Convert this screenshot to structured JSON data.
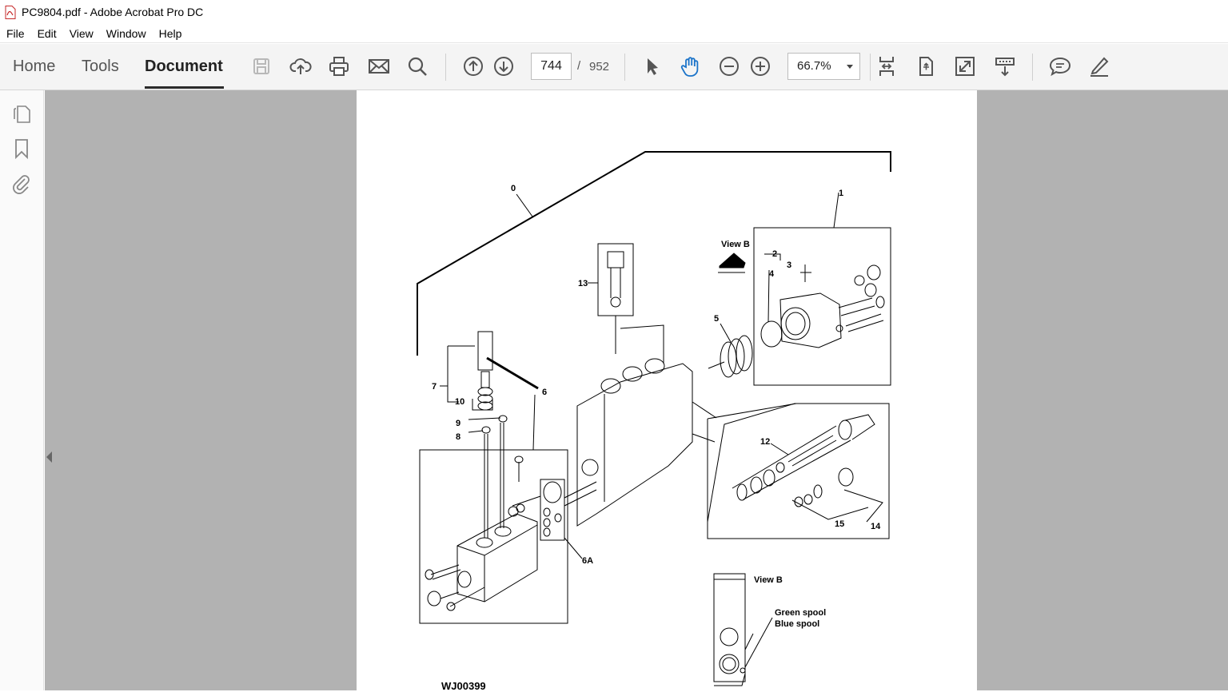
{
  "window": {
    "title": "PC9804.pdf - Adobe Acrobat Pro DC"
  },
  "menu": [
    "File",
    "Edit",
    "View",
    "Window",
    "Help"
  ],
  "tabs": {
    "home": "Home",
    "tools": "Tools",
    "document": "Document"
  },
  "navigation": {
    "current_page": "744",
    "separator": "/",
    "total_pages": "952"
  },
  "zoom": {
    "value": "66.7%"
  },
  "toolbar_icons": [
    "save-icon",
    "cloud-upload-icon",
    "print-icon",
    "email-icon",
    "search-icon",
    "page-up-icon",
    "page-down-icon",
    "select-cursor-icon",
    "hand-tool-icon",
    "zoom-out-icon",
    "zoom-in-icon",
    "fit-page-icon",
    "rotate-icon",
    "full-screen-icon",
    "scroll-mode-icon",
    "comment-icon",
    "sign-icon"
  ],
  "left_rail_icons": [
    "page-thumbnails-icon",
    "bookmarks-icon",
    "attachments-icon"
  ],
  "colors": {
    "toolbar_bg": "#f4f4f4",
    "doc_bg": "#b2b2b2",
    "active_tab": "#222222",
    "hand_tool": "#1a73c9"
  },
  "diagram": {
    "labels": {
      "l0": "0",
      "l1": "1",
      "l2": "2",
      "l3": "3",
      "l4": "4",
      "l5": "5",
      "l6": "6",
      "l6a": "6A",
      "l7": "7",
      "l8": "8",
      "l9": "9",
      "l10": "10",
      "l12": "12",
      "l13": "13",
      "l14": "14",
      "l15": "15",
      "view_b_top": "View B",
      "view_b_bottom": "View B",
      "green_spool": "Green spool",
      "blue_spool": "Blue spool"
    },
    "figure_id": "WJ00399"
  }
}
